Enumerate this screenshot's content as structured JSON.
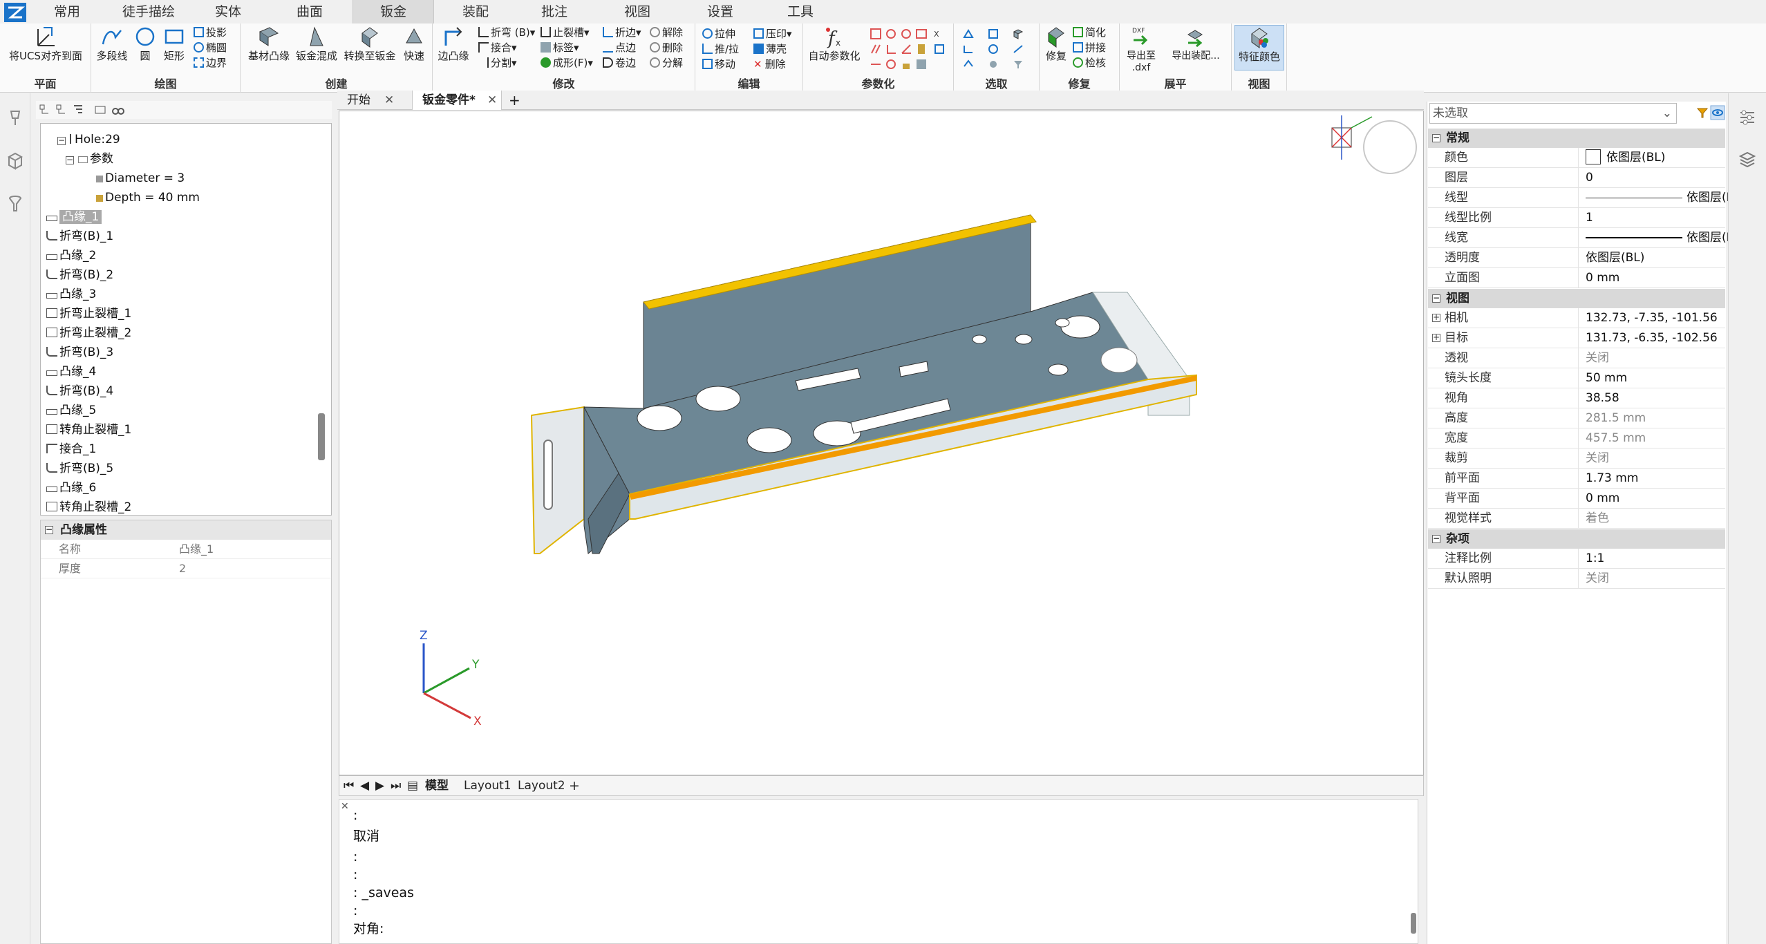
{
  "menu": {
    "tabs": [
      {
        "label": "常用"
      },
      {
        "label": "徒手描绘"
      },
      {
        "label": "实体"
      },
      {
        "label": "曲面"
      },
      {
        "label": "钣金"
      },
      {
        "label": "装配"
      },
      {
        "label": "批注"
      },
      {
        "label": "视图"
      },
      {
        "label": "设置"
      },
      {
        "label": "工具"
      }
    ],
    "active_tab": "钣金"
  },
  "ribbon": {
    "groups": {
      "plane": "平面",
      "draw": "绘图",
      "create": "创建",
      "modify": "修改",
      "edit": "编辑",
      "param": "参数化",
      "select": "选取",
      "repair": "修复",
      "unfold": "展平",
      "view": "视图"
    },
    "buttons": {
      "align_ucs": "将UCS对齐到面",
      "polyline": "多段线",
      "circle": "圆",
      "rectangle": "矩形",
      "projection": "投影",
      "ellipse": "椭圆",
      "boundary": "边界",
      "base_flange": "基材凸缘",
      "sm_blend": "钣金混成",
      "convert_sm": "转换至钣金",
      "quick": "快速",
      "edge_flange": "边凸缘",
      "bend_b": "折弯 (B)",
      "junction": "接合",
      "split": "分割",
      "relief": "止裂槽",
      "label": "标签",
      "form_f": "成形(F)",
      "fold": "折边",
      "point_edge": "点边",
      "roll_edge": "卷边",
      "unbend": "解除",
      "delete": "删除",
      "dissect": "分解",
      "stretch": "拉伸",
      "push_pull": "推/拉",
      "move": "移动",
      "emboss": "压印",
      "shell": "薄壳",
      "remove": "删除",
      "auto_param": "自动参数化",
      "heal": "修复",
      "simplify": "简化",
      "stitch": "拼接",
      "check": "检核",
      "export_dxf": "导出至",
      "export_dxf_sub": ".dxf",
      "export_asm": "导出装配...",
      "feature_color": "特征颜色",
      "dxf_badge": "DXF"
    }
  },
  "tree": {
    "items": [
      {
        "label": "Hole:29"
      },
      {
        "label": "参数"
      },
      {
        "label": "Diameter = 3"
      },
      {
        "label": "Depth = 40 mm"
      },
      {
        "label": "凸缘_1"
      },
      {
        "label": "折弯(B)_1"
      },
      {
        "label": "凸缘_2"
      },
      {
        "label": "折弯(B)_2"
      },
      {
        "label": "凸缘_3"
      },
      {
        "label": "折弯止裂槽_1"
      },
      {
        "label": "折弯止裂槽_2"
      },
      {
        "label": "折弯(B)_3"
      },
      {
        "label": "凸缘_4"
      },
      {
        "label": "折弯(B)_4"
      },
      {
        "label": "凸缘_5"
      },
      {
        "label": "转角止裂槽_1"
      },
      {
        "label": "接合_1"
      },
      {
        "label": "折弯(B)_5"
      },
      {
        "label": "凸缘_6"
      },
      {
        "label": "转角止裂槽_2"
      }
    ]
  },
  "feature_props": {
    "title": "凸缘属性",
    "rows": [
      {
        "key": "名称",
        "value": "凸缘_1"
      },
      {
        "key": "厚度",
        "value": "2"
      }
    ]
  },
  "doc_tabs": [
    {
      "label": "开始"
    },
    {
      "label": "钣金零件*"
    }
  ],
  "layout_tabs": [
    {
      "label": "模型"
    },
    {
      "label": "Layout1"
    },
    {
      "label": "Layout2"
    }
  ],
  "command": {
    "lines": [
      ":",
      "取消",
      ":",
      ":",
      ": _saveas",
      ":",
      "对角:"
    ]
  },
  "axes": {
    "x": "X",
    "y": "Y",
    "z": "Z"
  },
  "properties": {
    "selection": "未选取",
    "sections": [
      {
        "title": "常规",
        "rows": [
          {
            "key": "颜色",
            "value": "依图层(BL)"
          },
          {
            "key": "图层",
            "value": "0"
          },
          {
            "key": "线型",
            "value": "依图层(BL)"
          },
          {
            "key": "线型比例",
            "value": "1"
          },
          {
            "key": "线宽",
            "value": "依图层(BL)"
          },
          {
            "key": "透明度",
            "value": "依图层(BL)"
          },
          {
            "key": "立面图",
            "value": "0 mm"
          }
        ]
      },
      {
        "title": "视图",
        "rows": [
          {
            "key": "相机",
            "value": "132.73, -7.35, -101.56"
          },
          {
            "key": "目标",
            "value": "131.73, -6.35, -102.56"
          },
          {
            "key": "透视",
            "value": "关闭"
          },
          {
            "key": "镜头长度",
            "value": "50 mm"
          },
          {
            "key": "视角",
            "value": "38.58"
          },
          {
            "key": "高度",
            "value": "281.5 mm"
          },
          {
            "key": "宽度",
            "value": "457.5 mm"
          },
          {
            "key": "裁剪",
            "value": "关闭"
          },
          {
            "key": "前平面",
            "value": "1.73 mm"
          },
          {
            "key": "背平面",
            "value": "0 mm"
          },
          {
            "key": "视觉样式",
            "value": "着色"
          }
        ]
      },
      {
        "title": "杂项",
        "rows": [
          {
            "key": "注释比例",
            "value": "1:1"
          },
          {
            "key": "默认照明",
            "value": "关闭"
          }
        ]
      }
    ]
  },
  "colors": {
    "accent": "#1a73c9",
    "model_face": "#6b8493",
    "model_edge": "#f2c200",
    "axis_x": "#d33a3a",
    "axis_y": "#2a9a2a",
    "axis_z": "#2a55c8"
  }
}
